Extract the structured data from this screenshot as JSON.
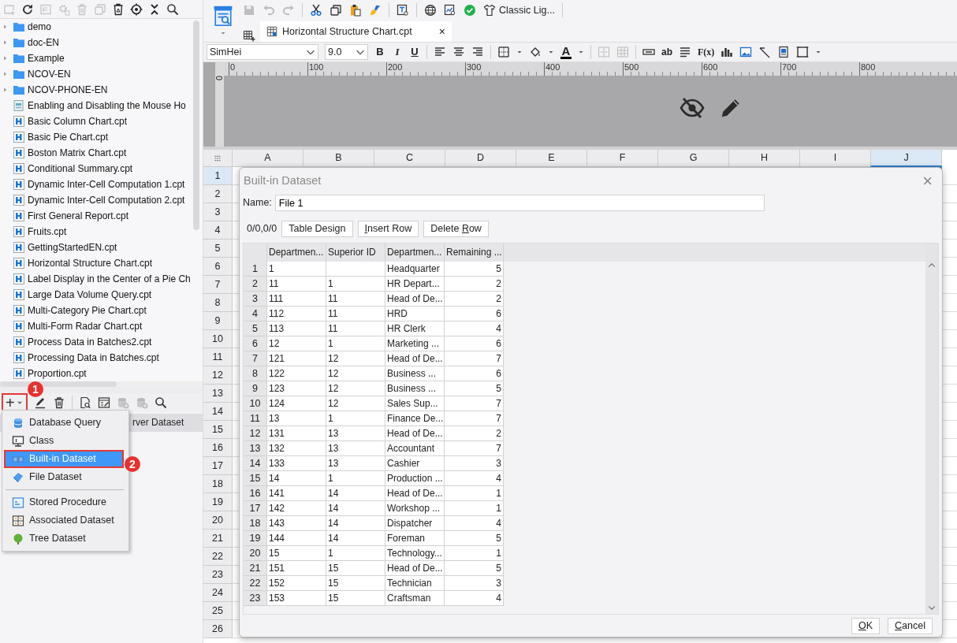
{
  "file_panel": {
    "tree": [
      {
        "label": "demo",
        "kind": "folder"
      },
      {
        "label": "doc-EN",
        "kind": "folder"
      },
      {
        "label": "Example",
        "kind": "folder"
      },
      {
        "label": "NCOV-EN",
        "kind": "folder"
      },
      {
        "label": "NCOV-PHONE-EN",
        "kind": "folder"
      },
      {
        "label": "Enabling and Disabling the Mouse Ho",
        "kind": "form"
      },
      {
        "label": "Basic Column Chart.cpt",
        "kind": "report"
      },
      {
        "label": "Basic Pie Chart.cpt",
        "kind": "report"
      },
      {
        "label": "Boston Matrix Chart.cpt",
        "kind": "report"
      },
      {
        "label": "Conditional Summary.cpt",
        "kind": "report"
      },
      {
        "label": "Dynamic Inter-Cell Computation 1.cpt",
        "kind": "report"
      },
      {
        "label": "Dynamic Inter-Cell Computation 2.cpt",
        "kind": "report"
      },
      {
        "label": "First General Report.cpt",
        "kind": "report"
      },
      {
        "label": "Fruits.cpt",
        "kind": "report"
      },
      {
        "label": "GettingStartedEN.cpt",
        "kind": "report"
      },
      {
        "label": "Horizontal Structure Chart.cpt",
        "kind": "report"
      },
      {
        "label": "Label Display in the Center of a Pie Ch",
        "kind": "report"
      },
      {
        "label": "Large Data Volume Query.cpt",
        "kind": "report"
      },
      {
        "label": "Multi-Category Pie Chart.cpt",
        "kind": "report"
      },
      {
        "label": "Multi-Form Radar Chart.cpt",
        "kind": "report"
      },
      {
        "label": "Process Data in Batches2.cpt",
        "kind": "report"
      },
      {
        "label": "Processing Data in Batches.cpt",
        "kind": "report"
      },
      {
        "label": "Proportion.cpt",
        "kind": "report"
      }
    ]
  },
  "dataset_panel": {
    "add_button": {
      "label": "+",
      "annotated": true
    },
    "rows": [
      {
        "label": "rver Dataset",
        "selected": true
      }
    ]
  },
  "add_menu": {
    "sections": [
      {
        "items": [
          {
            "label": "Database Query",
            "kind": "database",
            "selected": false,
            "annotated": false
          },
          {
            "label": "Class",
            "kind": "class",
            "selected": false,
            "annotated": false
          },
          {
            "label": "Built-in Dataset",
            "kind": "builtin",
            "selected": true,
            "annotated": true
          },
          {
            "label": "File Dataset",
            "kind": "file",
            "selected": false,
            "annotated": false
          }
        ]
      },
      {
        "items": [
          {
            "label": "Stored Procedure",
            "kind": "procedure",
            "selected": false,
            "annotated": false
          },
          {
            "label": "Associated Dataset",
            "kind": "associated",
            "selected": false,
            "annotated": false
          },
          {
            "label": "Tree Dataset",
            "kind": "tree",
            "selected": false,
            "annotated": false
          }
        ]
      }
    ]
  },
  "annotations": [
    {
      "number": "1"
    },
    {
      "number": "2"
    }
  ],
  "toolbar": {
    "theme_button": "Classic Lig..."
  },
  "tabs": [
    {
      "label": "Horizontal Structure Chart.cpt",
      "close": "×",
      "selected": true
    }
  ],
  "format_toolbar": {
    "font": "SimHei",
    "font_size": "9.0",
    "bold": "B",
    "italic": "I",
    "underline": "U",
    "font_color": "A",
    "text_tool": "ab",
    "formula_tool": "F(x)"
  },
  "ruler": {
    "vertical_label": "0",
    "labels": [
      "0",
      "100",
      "200",
      "300",
      "400",
      "500",
      "600",
      "700",
      "800"
    ]
  },
  "sheet": {
    "columns": [
      {
        "label": "A",
        "selected": false
      },
      {
        "label": "B",
        "selected": false
      },
      {
        "label": "C",
        "selected": false
      },
      {
        "label": "D",
        "selected": false
      },
      {
        "label": "E",
        "selected": false
      },
      {
        "label": "F",
        "selected": false
      },
      {
        "label": "G",
        "selected": false
      },
      {
        "label": "H",
        "selected": false
      },
      {
        "label": "I",
        "selected": false
      },
      {
        "label": "J",
        "selected": true
      }
    ],
    "rows": [
      {
        "label": "1",
        "selected": true
      },
      {
        "label": "2",
        "selected": false
      },
      {
        "label": "3",
        "selected": false
      },
      {
        "label": "4",
        "selected": false
      },
      {
        "label": "5",
        "selected": false
      },
      {
        "label": "6",
        "selected": false
      },
      {
        "label": "7",
        "selected": false
      },
      {
        "label": "8",
        "selected": false
      },
      {
        "label": "9",
        "selected": false
      },
      {
        "label": "10",
        "selected": false
      },
      {
        "label": "11",
        "selected": false
      },
      {
        "label": "12",
        "selected": false
      },
      {
        "label": "13",
        "selected": false
      },
      {
        "label": "14",
        "selected": false
      },
      {
        "label": "15",
        "selected": false
      },
      {
        "label": "16",
        "selected": false
      },
      {
        "label": "17",
        "selected": false
      },
      {
        "label": "18",
        "selected": false
      },
      {
        "label": "19",
        "selected": false
      },
      {
        "label": "20",
        "selected": false
      },
      {
        "label": "21",
        "selected": false
      },
      {
        "label": "22",
        "selected": false
      },
      {
        "label": "23",
        "selected": false
      },
      {
        "label": "24",
        "selected": false
      },
      {
        "label": "25",
        "selected": false
      },
      {
        "label": "26",
        "selected": false
      }
    ]
  },
  "dialog": {
    "title": "Built-in Dataset",
    "close": "×",
    "name_label": "Name:",
    "name_value": "File 1",
    "position": "0/0,0/0",
    "buttons": [
      {
        "before": "Table Design"
      },
      {
        "mnemonic": "I",
        "after": "nsert Row"
      },
      {
        "before": "Delete ",
        "mnemonic": "R",
        "after": "ow"
      }
    ],
    "table": {
      "columns": [
        "Departmen...",
        "Superior ID",
        "Departmen...",
        "Remaining ..."
      ],
      "rows": [
        {
          "number": "1",
          "cells": {
            "column_1": "1",
            "column_3": "Headquarter",
            "column_4": "5"
          }
        },
        {
          "number": "2",
          "cells": {
            "column_1": "11",
            "column_2": "1",
            "column_3": "HR Depart...",
            "column_4": "2"
          }
        },
        {
          "number": "3",
          "cells": {
            "column_1": "111",
            "column_2": "11",
            "column_3": "Head of De...",
            "column_4": "2"
          }
        },
        {
          "number": "4",
          "cells": {
            "column_1": "112",
            "column_2": "11",
            "column_3": "HRD",
            "column_4": "6"
          }
        },
        {
          "number": "5",
          "cells": {
            "column_1": "113",
            "column_2": "11",
            "column_3": "HR Clerk",
            "column_4": "4"
          }
        },
        {
          "number": "6",
          "cells": {
            "column_1": "12",
            "column_2": "1",
            "column_3": "Marketing ...",
            "column_4": "6"
          }
        },
        {
          "number": "7",
          "cells": {
            "column_1": "121",
            "column_2": "12",
            "column_3": "Head of De...",
            "column_4": "7"
          }
        },
        {
          "number": "8",
          "cells": {
            "column_1": "122",
            "column_2": "12",
            "column_3": "Business ...",
            "column_4": "6"
          }
        },
        {
          "number": "9",
          "cells": {
            "column_1": "123",
            "column_2": "12",
            "column_3": "Business ...",
            "column_4": "5"
          }
        },
        {
          "number": "10",
          "cells": {
            "column_1": "124",
            "column_2": "12",
            "column_3": "Sales Sup...",
            "column_4": "7"
          }
        },
        {
          "number": "11",
          "cells": {
            "column_1": "13",
            "column_2": "1",
            "column_3": "Finance De...",
            "column_4": "7"
          }
        },
        {
          "number": "12",
          "cells": {
            "column_1": "131",
            "column_2": "13",
            "column_3": "Head of De...",
            "column_4": "2"
          }
        },
        {
          "number": "13",
          "cells": {
            "column_1": "132",
            "column_2": "13",
            "column_3": "Accountant",
            "column_4": "7"
          }
        },
        {
          "number": "14",
          "cells": {
            "column_1": "133",
            "column_2": "13",
            "column_3": "Cashier",
            "column_4": "3"
          }
        },
        {
          "number": "15",
          "cells": {
            "column_1": "14",
            "column_2": "1",
            "column_3": "Production ...",
            "column_4": "4"
          }
        },
        {
          "number": "16",
          "cells": {
            "column_1": "141",
            "column_2": "14",
            "column_3": "Head of De...",
            "column_4": "1"
          }
        },
        {
          "number": "17",
          "cells": {
            "column_1": "142",
            "column_2": "14",
            "column_3": "Workshop ...",
            "column_4": "1"
          }
        },
        {
          "number": "18",
          "cells": {
            "column_1": "143",
            "column_2": "14",
            "column_3": "Dispatcher",
            "column_4": "4"
          }
        },
        {
          "number": "19",
          "cells": {
            "column_1": "144",
            "column_2": "14",
            "column_3": "Foreman",
            "column_4": "5"
          }
        },
        {
          "number": "20",
          "cells": {
            "column_1": "15",
            "column_2": "1",
            "column_3": "Technology...",
            "column_4": "1"
          }
        },
        {
          "number": "21",
          "cells": {
            "column_1": "151",
            "column_2": "15",
            "column_3": "Head of De...",
            "column_4": "5"
          }
        },
        {
          "number": "22",
          "cells": {
            "column_1": "152",
            "column_2": "15",
            "column_3": "Technician",
            "column_4": "3"
          }
        },
        {
          "number": "23",
          "cells": {
            "column_1": "153",
            "column_2": "15",
            "column_3": "Craftsman",
            "column_4": "4"
          }
        }
      ]
    },
    "footer_buttons": [
      {
        "mnemonic": "O",
        "after": "K"
      },
      {
        "mnemonic": "C",
        "after": "ancel"
      }
    ]
  }
}
